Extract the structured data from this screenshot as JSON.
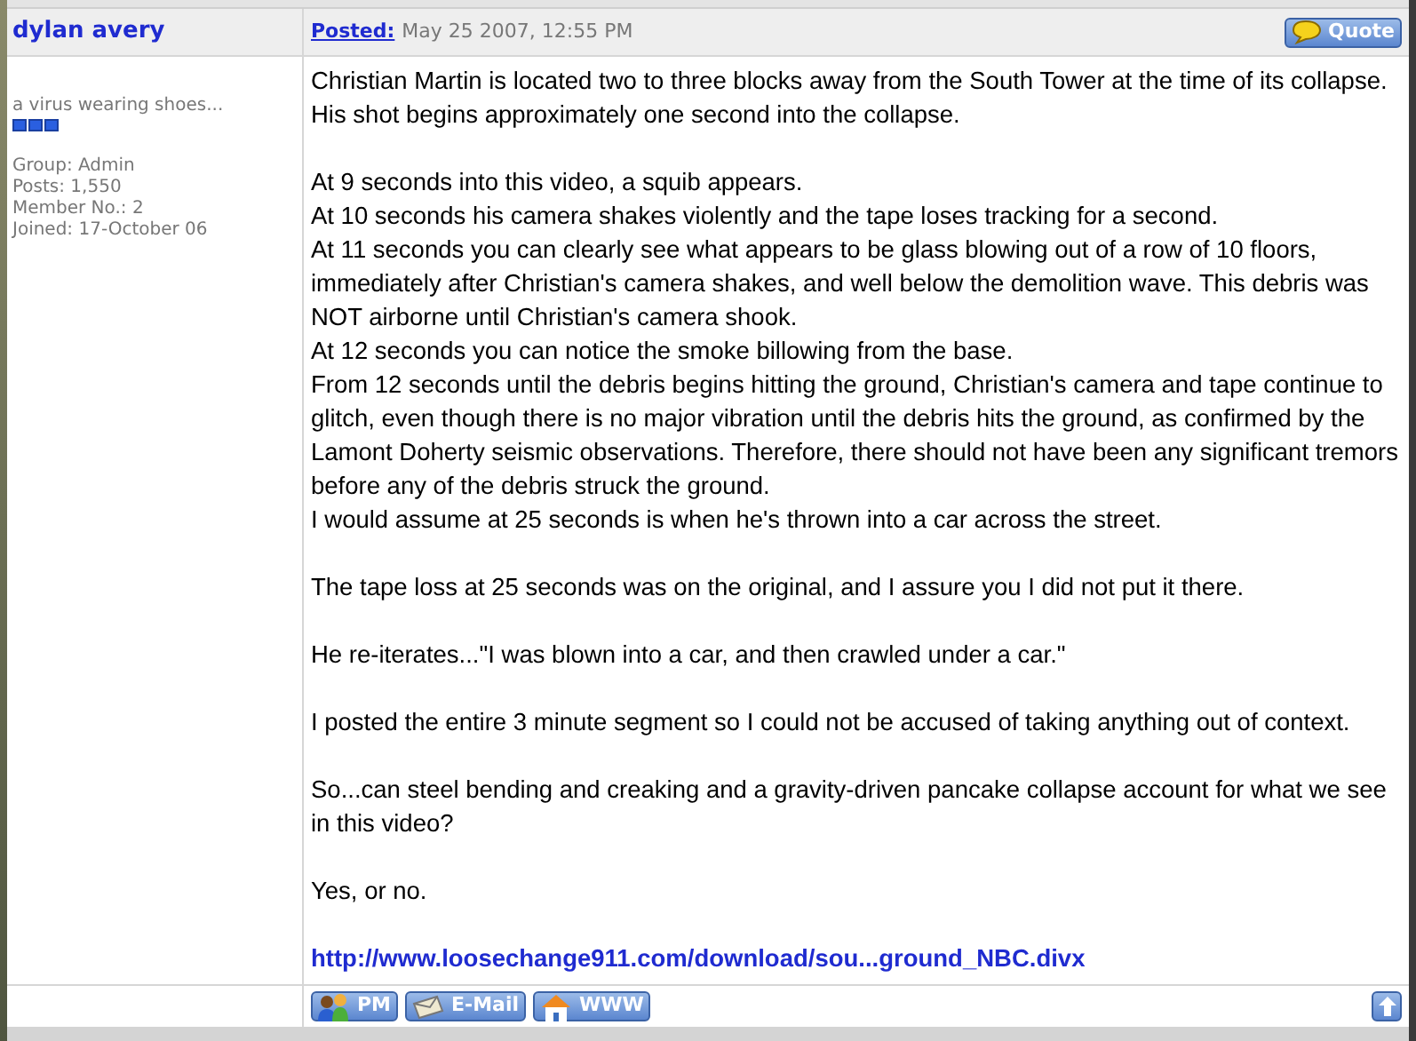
{
  "author": {
    "name": "dylan avery",
    "title": "a virus wearing shoes...",
    "stars": 3,
    "details": [
      "Group: Admin",
      "Posts: 1,550",
      "Member No.: 2",
      "Joined: 17-October 06"
    ]
  },
  "post": {
    "posted_label": "Posted:",
    "date": "May 25 2007, 12:55 PM",
    "quote_button": "Quote",
    "blocks": [
      [
        "Christian Martin is located two to three blocks away from the South Tower at the time of its collapse. His shot begins approximately one second into the collapse."
      ],
      [
        "At 9 seconds into this video, a squib appears.",
        "At 10 seconds his camera shakes violently and the tape loses tracking for a second.",
        "At 11 seconds you can clearly see what appears to be glass blowing out of a row of 10 floors, immediately after Christian's camera shakes, and well below the demolition wave. This debris was NOT airborne until Christian's camera shook.",
        "At 12 seconds you can notice the smoke billowing from the base.",
        "From 12 seconds until the debris begins hitting the ground, Christian's camera and tape continue to glitch, even though there is no major vibration until the debris hits the ground, as confirmed by the Lamont Doherty seismic observations. Therefore, there should not have been any significant tremors before any of the debris struck the ground.",
        "I would assume at 25 seconds is when he's thrown into a car across the street."
      ],
      [
        "The tape loss at 25 seconds was on the original, and I assure you I did not put it there."
      ],
      [
        "He re-iterates...\"I was blown into a car, and then crawled under a car.\""
      ],
      [
        "I posted the entire 3 minute segment so I could not be accused of taking anything out of context."
      ],
      [
        "So...can steel bending and creaking and a gravity-driven pancake collapse account for what we see in this video?"
      ],
      [
        "Yes, or no."
      ]
    ],
    "link": "http://www.loosechange911.com/download/sou...ground_NBC.divx"
  },
  "footer_buttons": [
    {
      "kind": "pm",
      "label": "PM"
    },
    {
      "kind": "email",
      "label": "E-Mail"
    },
    {
      "kind": "www",
      "label": "WWW"
    }
  ]
}
